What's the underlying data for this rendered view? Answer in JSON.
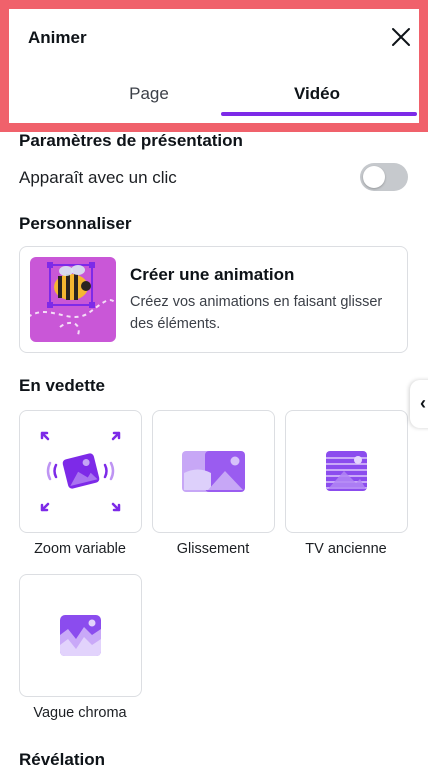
{
  "header": {
    "title": "Animer",
    "close_icon": "close-icon",
    "tabs": [
      {
        "label": "Page",
        "active": false
      },
      {
        "label": "Vidéo",
        "active": true
      }
    ],
    "accent_color": "#7d2ae8",
    "highlight_color": "#f0616b"
  },
  "presentation": {
    "title": "Paramètres de présentation",
    "on_click_label": "Apparaît avec un clic",
    "on_click_enabled": false
  },
  "customize": {
    "title": "Personnaliser",
    "card_title": "Créer une animation",
    "card_description": "Créez vos animations en faisant glisser des éléments.",
    "thumb_icon": "bee-icon"
  },
  "featured": {
    "title": "En vedette",
    "items": [
      {
        "label": "Zoom variable",
        "icon": "zoom-variable-icon"
      },
      {
        "label": "Glissement",
        "icon": "slide-images-icon"
      },
      {
        "label": "TV ancienne",
        "icon": "old-tv-icon"
      },
      {
        "label": "Vague chroma",
        "icon": "chroma-wave-icon"
      }
    ]
  },
  "reveal": {
    "title": "Révélation"
  },
  "side_handle_icon": "chevron-left-icon"
}
